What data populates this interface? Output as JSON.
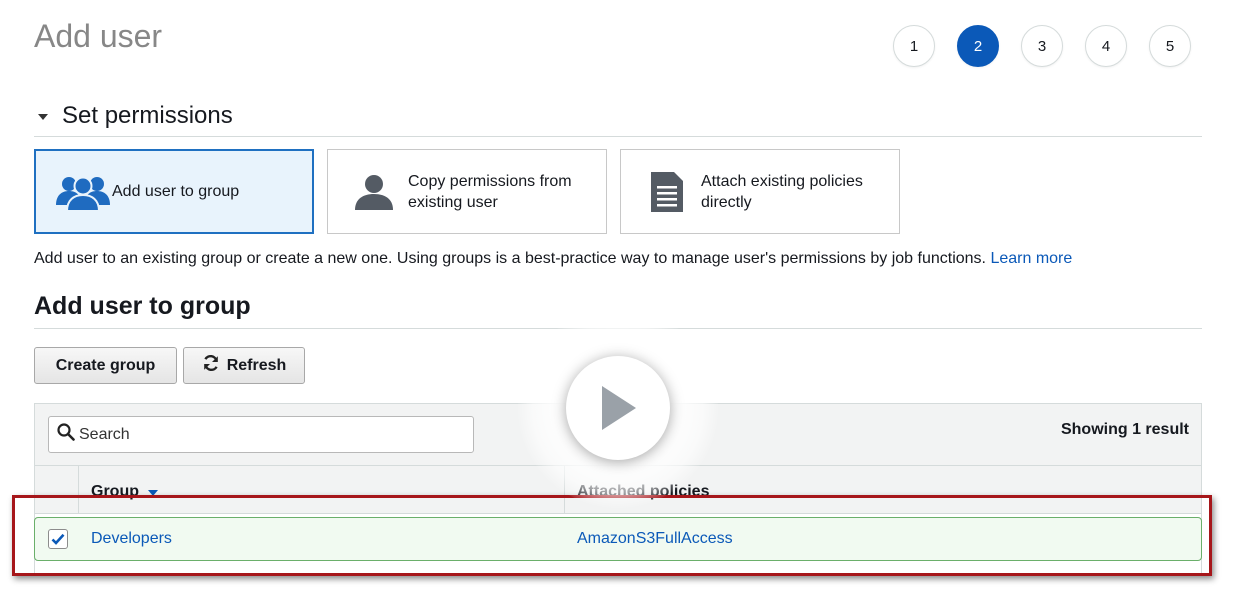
{
  "page": {
    "title": "Add user"
  },
  "steps": {
    "items": [
      "1",
      "2",
      "3",
      "4",
      "5"
    ],
    "active_index": 1
  },
  "colors": {
    "accent": "#0b59b8",
    "selected_bg": "#e8f3fc",
    "row_border": "#6aaf6a",
    "highlight": "#a6161a"
  },
  "permissions": {
    "section_title": "Set permissions",
    "options": [
      {
        "icon": "users-group-icon",
        "label": "Add user to group",
        "selected": true
      },
      {
        "icon": "user-icon",
        "label_line1": "Copy permissions from",
        "label_line2": "existing user",
        "selected": false
      },
      {
        "icon": "document-icon",
        "label_line1": "Attach existing policies",
        "label_line2": "directly",
        "selected": false
      }
    ],
    "description": "Add user to an existing group or create a new one. Using groups is a best-practice way to manage user's permissions by job functions.",
    "learn_more": "Learn more"
  },
  "group_section": {
    "title": "Add user to group",
    "buttons": {
      "create": "Create group",
      "refresh": "Refresh"
    },
    "search": {
      "placeholder": "Search",
      "value": ""
    },
    "result_count": "Showing 1 result",
    "columns": {
      "group": "Group",
      "attached_policies": "Attached policies"
    },
    "rows": [
      {
        "checked": true,
        "group": "Developers",
        "attached_policies": "AmazonS3FullAccess"
      }
    ]
  },
  "overlay": {
    "icon": "play-icon"
  }
}
